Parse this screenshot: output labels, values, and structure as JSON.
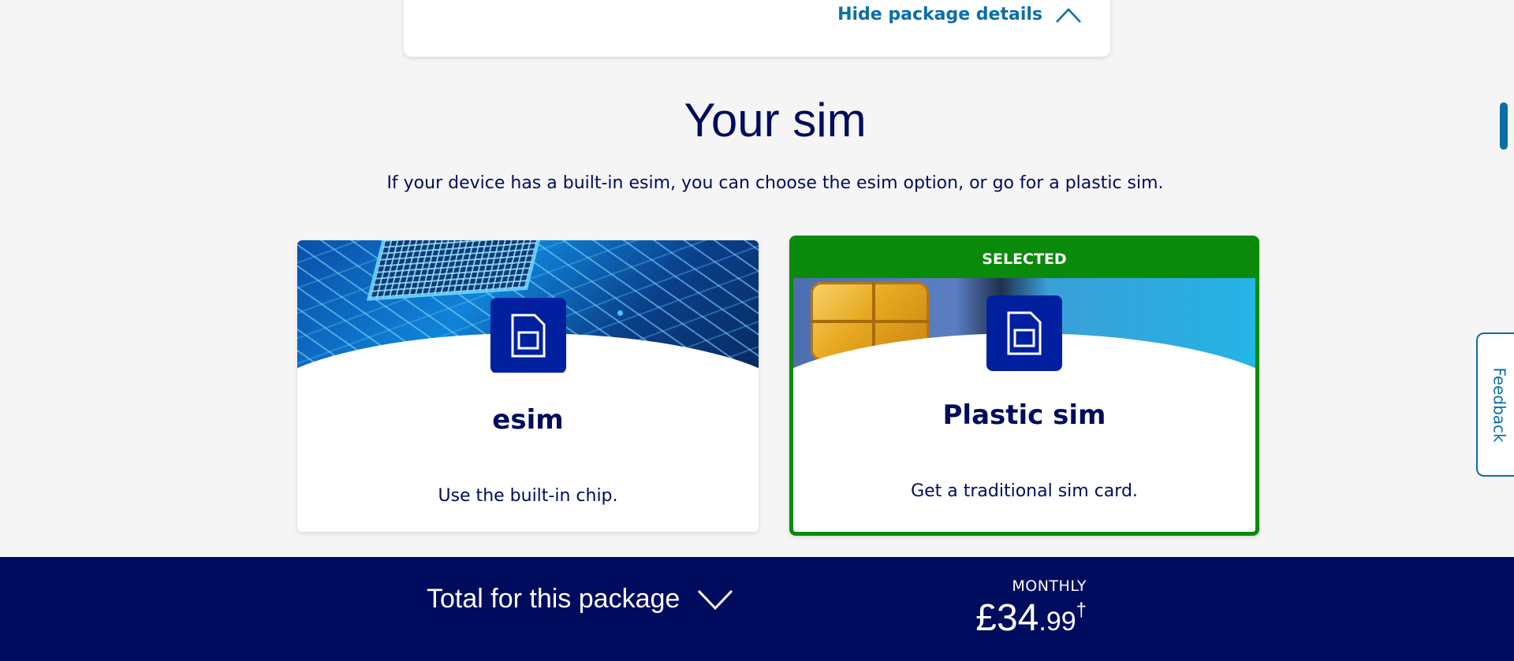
{
  "package_card": {
    "hide_details_label": "Hide package details"
  },
  "sim_section": {
    "title": "Your sim",
    "description": "If your device has a built-in esim, you can choose the esim option, or go for a plastic sim.",
    "options": [
      {
        "title": "esim",
        "description": "Use the built-in chip.",
        "selected": false
      },
      {
        "title": "Plastic sim",
        "description": "Get a traditional sim card.",
        "selected": true,
        "badge": "SELECTED"
      }
    ]
  },
  "total_bar": {
    "label": "Total for this package",
    "period": "MONTHLY",
    "price_main": "£34",
    "price_pence": ".99",
    "price_suffix": "†"
  },
  "feedback": {
    "label": "Feedback"
  },
  "colors": {
    "navy": "#000c5e",
    "link_blue": "#0b6ea8",
    "selected_green": "#0a8a0a",
    "icon_blue": "#00209f"
  },
  "icons": [
    "chevron-up-icon",
    "sim-card-icon",
    "chevron-down-icon"
  ]
}
